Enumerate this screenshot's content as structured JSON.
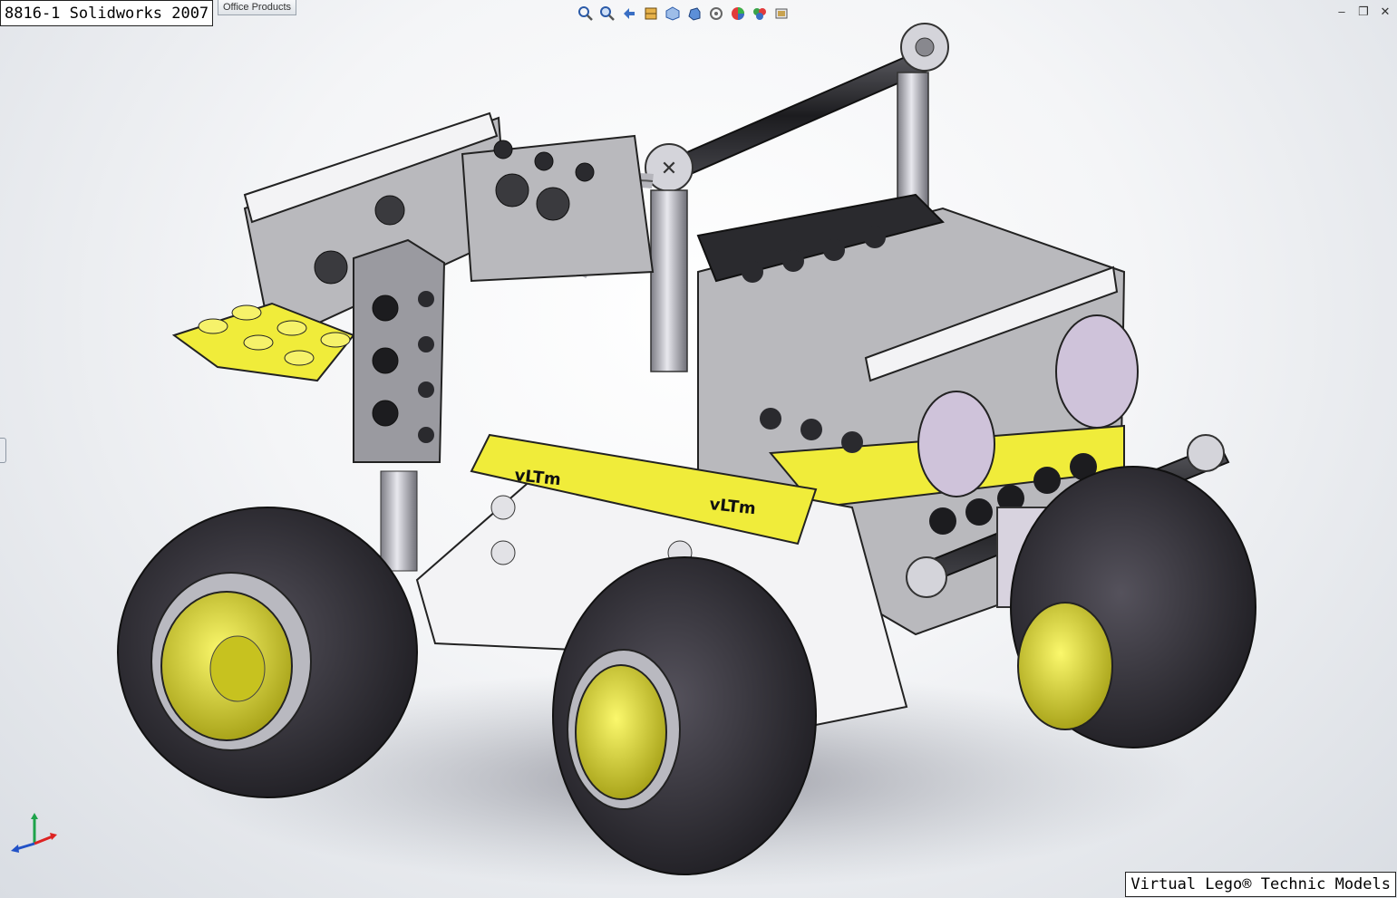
{
  "window": {
    "title_overlay": "8816-1 Solidworks 2007",
    "tabs": [
      {
        "label": "Office Products"
      }
    ]
  },
  "toolbar": {
    "icons": [
      "zoom-to-fit-icon",
      "zoom-area-icon",
      "previous-view-icon",
      "section-view-icon",
      "view-orientation-icon",
      "display-style-icon",
      "hide-show-items-icon",
      "edit-appearance-icon",
      "apply-scene-icon",
      "view-settings-icon"
    ]
  },
  "window_controls": [
    "minimize-icon",
    "restore-icon",
    "close-icon"
  ],
  "model": {
    "brand_marks": [
      "vLTm",
      "vLTm",
      "vLTm"
    ],
    "colors": {
      "brick_gray": "#b9b9bd",
      "brick_white": "#f3f3f5",
      "brick_black": "#2a2a2e",
      "plate_yellow": "#f0ec3a",
      "tire": "#3a3840",
      "hub": "#e9e43a",
      "headlight": "#cfc3da"
    }
  },
  "credit": {
    "text": "Virtual Lego® Technic Models"
  }
}
